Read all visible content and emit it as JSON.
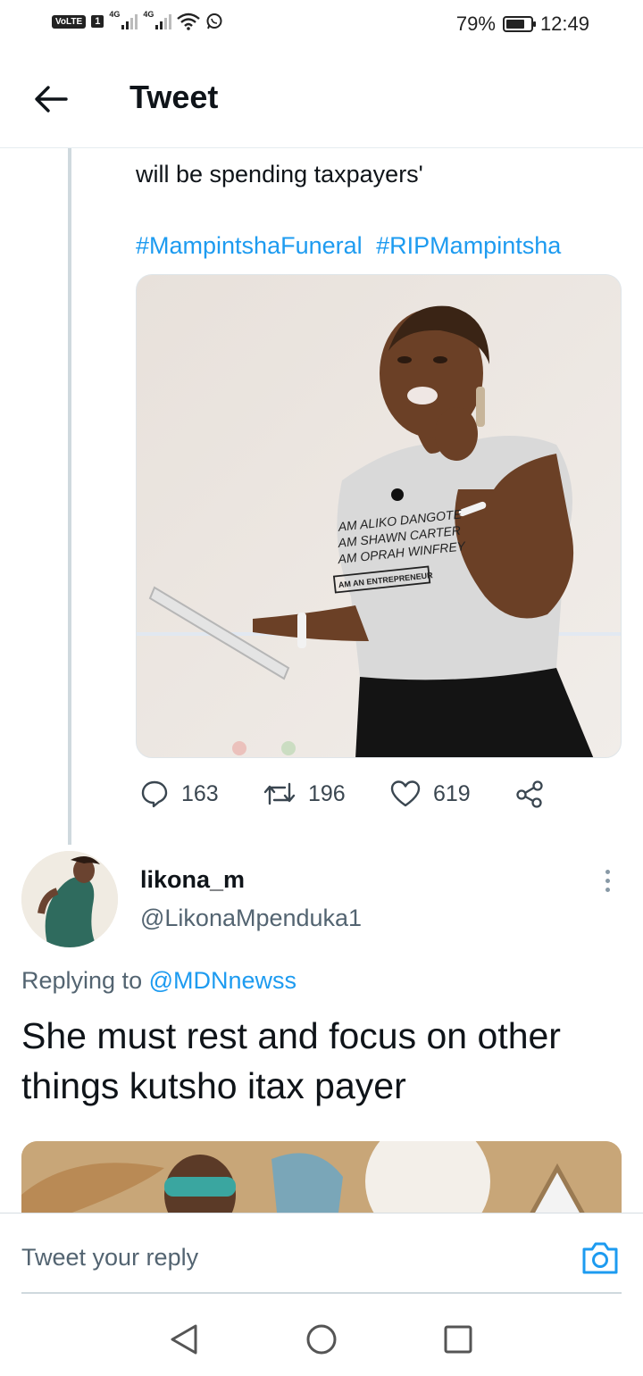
{
  "status_bar": {
    "network": "VoLTE",
    "sim": "1",
    "signal1_label": "4G",
    "signal2_label": "4G",
    "battery_percent": "79%",
    "battery_level": 0.79,
    "time": "12:49"
  },
  "header": {
    "title": "Tweet"
  },
  "tweet": {
    "text_partial": "will be spending taxpayers'",
    "hashtags": [
      "#MampintshaFuneral",
      "#RIPMampintsha"
    ],
    "image_shirt_lines": [
      "AM ALIKO DANGOTE",
      "AM SHAWN CARTER",
      "AM OPRAH WINFREY",
      "AM AN ENTREPRENEUR"
    ],
    "replies": "163",
    "retweets": "196",
    "likes": "619"
  },
  "reply": {
    "name": "likona_m",
    "handle": "@LikonaMpenduka1",
    "replying_prefix": "Replying to",
    "replying_to": "@MDNnewss",
    "text": "She must rest and focus on other things kutsho itax payer"
  },
  "compose": {
    "placeholder": "Tweet your reply"
  },
  "icons": {
    "back": "arrow-left-icon",
    "reply": "comment-icon",
    "retweet": "retweet-icon",
    "like": "heart-icon",
    "share": "share-icon",
    "more": "more-vertical-icon",
    "camera": "camera-icon"
  },
  "colors": {
    "link": "#1d9bf0",
    "secondary_text": "#536471",
    "primary_text": "#0f1419",
    "thread_line": "#cfd9de"
  }
}
